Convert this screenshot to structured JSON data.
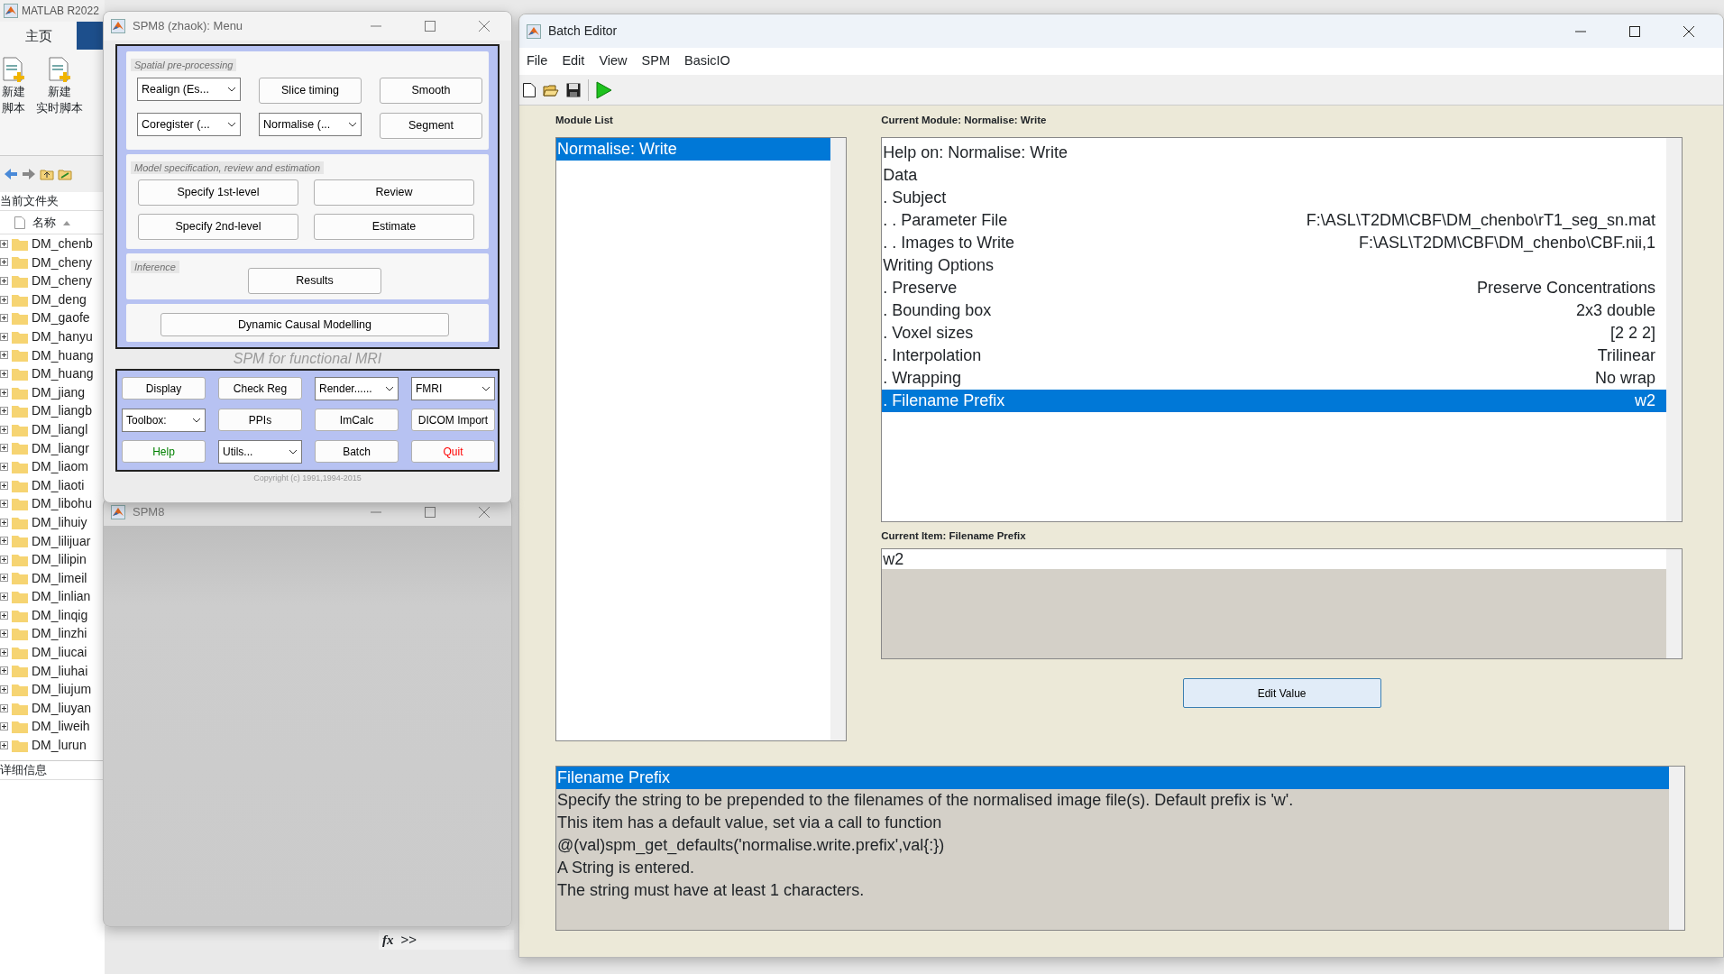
{
  "matlab": {
    "title": "MATLAB R2022",
    "tab": "主页",
    "ribbon_buttons": [
      {
        "lines": [
          "新建",
          "脚本"
        ]
      },
      {
        "lines": [
          "新建",
          "实时脚本"
        ]
      }
    ],
    "folder_label": "当前文件夹",
    "name_column": "名称",
    "files": [
      "DM_chenb",
      "DM_cheny",
      "DM_cheny",
      "DM_deng",
      "DM_gaofe",
      "DM_hanyu",
      "DM_huang",
      "DM_huang",
      "DM_jiang",
      "DM_liangb",
      "DM_liangl",
      "DM_liangr",
      "DM_liaom",
      "DM_liaoti",
      "DM_libohu",
      "DM_lihuiy",
      "DM_lilijuar",
      "DM_lilipin",
      "DM_limeil",
      "DM_linlian",
      "DM_linqig",
      "DM_linzhi",
      "DM_liucai",
      "DM_liuhai",
      "DM_liujum",
      "DM_liuyan",
      "DM_liweih",
      "DM_lurun"
    ],
    "details_label": "详细信息",
    "fx": "fx",
    "prompt": ">>"
  },
  "spm_menu": {
    "title": "SPM8 (zhaok): Menu",
    "sections": [
      {
        "label": "Spatial pre-processing",
        "controls": [
          {
            "kind": "dropdown",
            "label": "Realign (Es..."
          },
          {
            "kind": "button",
            "label": "Slice timing"
          },
          {
            "kind": "button",
            "label": "Smooth"
          },
          {
            "kind": "dropdown",
            "label": "Coregister (..."
          },
          {
            "kind": "dropdown",
            "label": "Normalise (..."
          },
          {
            "kind": "button",
            "label": "Segment"
          }
        ]
      },
      {
        "label": "Model specification, review and estimation",
        "controls": [
          {
            "kind": "button",
            "label": "Specify 1st-level"
          },
          {
            "kind": "button",
            "label": "Review"
          },
          {
            "kind": "button",
            "label": "Specify 2nd-level"
          },
          {
            "kind": "button",
            "label": "Estimate"
          }
        ]
      },
      {
        "label": "Inference",
        "controls": [
          {
            "kind": "button",
            "label": "Results"
          }
        ]
      },
      {
        "controls": [
          {
            "kind": "button",
            "label": "Dynamic Causal Modelling"
          }
        ]
      }
    ],
    "subtitle": "SPM for functional MRI",
    "tools": [
      {
        "kind": "button",
        "label": "Display"
      },
      {
        "kind": "button",
        "label": "Check Reg"
      },
      {
        "kind": "dropdown",
        "label": "Render......"
      },
      {
        "kind": "dropdown",
        "label": "FMRI"
      },
      {
        "kind": "dropdown",
        "label": "Toolbox:"
      },
      {
        "kind": "button",
        "label": "PPIs"
      },
      {
        "kind": "button",
        "label": "ImCalc"
      },
      {
        "kind": "button",
        "label": "DICOM Import"
      },
      {
        "kind": "button",
        "label": "Help",
        "color": "#008000"
      },
      {
        "kind": "dropdown",
        "label": "Utils..."
      },
      {
        "kind": "button",
        "label": "Batch"
      },
      {
        "kind": "button",
        "label": "Quit",
        "color": "#ff0000"
      }
    ],
    "copyright": "Copyright (c) 1991,1994-2015"
  },
  "spm_window": {
    "title": "SPM8"
  },
  "batch_editor": {
    "title": "Batch Editor",
    "menu": [
      "File",
      "Edit",
      "View",
      "SPM",
      "BasicIO"
    ],
    "module_list": {
      "label": "Module List",
      "items": [
        {
          "text": "Normalise: Write",
          "selected": true
        }
      ]
    },
    "current_module": {
      "label": "Current Module: Normalise: Write",
      "rows": [
        {
          "name": "Help on: Normalise: Write",
          "selected": false
        },
        {
          "name": "Data",
          "selected": false
        },
        {
          "name": ". Subject",
          "selected": false
        },
        {
          "name": ". . Parameter File",
          "value": "F:\\ASL\\T2DM\\CBF\\DM_chenbo\\rT1_seg_sn.mat",
          "selected": false
        },
        {
          "name": ". . Images to Write",
          "value": "F:\\ASL\\T2DM\\CBF\\DM_chenbo\\CBF.nii,1",
          "selected": false
        },
        {
          "name": "Writing Options",
          "selected": false
        },
        {
          "name": ". Preserve",
          "value": "Preserve Concentrations",
          "selected": false
        },
        {
          "name": ". Bounding box",
          "value": "2x3 double",
          "selected": false
        },
        {
          "name": ". Voxel sizes",
          "value": "[2 2 2]",
          "selected": false
        },
        {
          "name": ". Interpolation",
          "value": "Trilinear",
          "selected": false
        },
        {
          "name": ". Wrapping",
          "value": "No wrap",
          "selected": false
        },
        {
          "name": ". Filename Prefix",
          "value": "w2",
          "selected": true
        }
      ]
    },
    "current_item": {
      "label": "Current Item: Filename Prefix",
      "value": "w2"
    },
    "edit_button": "Edit Value",
    "item_help": [
      {
        "text": "Filename Prefix",
        "selected": true
      },
      {
        "text": "Specify the string to be prepended to the filenames of the normalised image file(s). Default prefix is 'w'.",
        "selected": false
      },
      {
        "text": "This item has a default value, set via a call to function",
        "selected": false
      },
      {
        "text": "@(val)spm_get_defaults('normalise.write.prefix',val{:})",
        "selected": false
      },
      {
        "text": "A String is entered.",
        "selected": false
      },
      {
        "text": "The string must have at least 1 characters.",
        "selected": false
      }
    ]
  }
}
